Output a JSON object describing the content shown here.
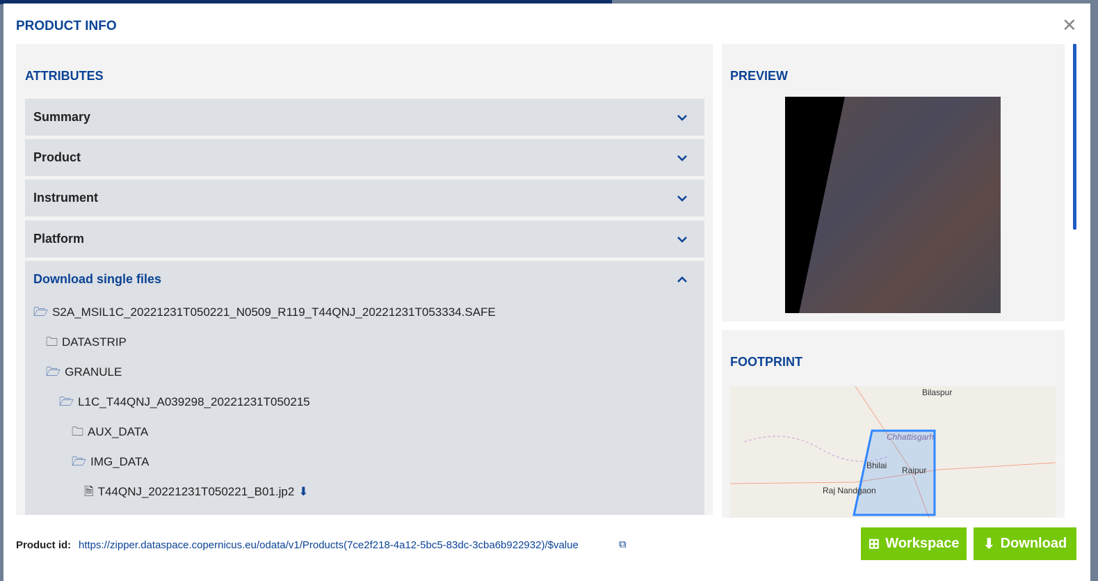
{
  "modal": {
    "title": "PRODUCT INFO",
    "close_icon": "close-icon"
  },
  "attributes": {
    "heading": "ATTRIBUTES",
    "sections": [
      {
        "label": "Summary",
        "expanded": false
      },
      {
        "label": "Product",
        "expanded": false
      },
      {
        "label": "Instrument",
        "expanded": false
      },
      {
        "label": "Platform",
        "expanded": false
      },
      {
        "label": "Download single files",
        "expanded": true
      }
    ]
  },
  "files": [
    {
      "name": "S2A_MSIL1C_20221231T050221_N0509_R119_T44QNJ_20221231T053334.SAFE",
      "type": "folder-open"
    },
    {
      "name": "DATASTRIP",
      "type": "folder"
    },
    {
      "name": "GRANULE",
      "type": "folder-open"
    },
    {
      "name": "L1C_T44QNJ_A039298_20221231T050215",
      "type": "folder-open"
    },
    {
      "name": "AUX_DATA",
      "type": "folder"
    },
    {
      "name": "IMG_DATA",
      "type": "folder-open"
    },
    {
      "name": "T44QNJ_20221231T050221_B01.jp2",
      "type": "file"
    }
  ],
  "preview": {
    "heading": "PREVIEW"
  },
  "footprint": {
    "heading": "FOOTPRINT",
    "labels": {
      "bilaspur": "Bilaspur",
      "chhattisgarh": "Chhattisgarh",
      "bhilai": "Bhilai",
      "raipur": "Raipur",
      "rajnandgaon": "Raj Nandgaon"
    },
    "polygon_color": "#2f86ff"
  },
  "footer": {
    "product_id_label": "Product id:",
    "product_id": "https://zipper.dataspace.copernicus.eu/odata/v1/Products(7ce2f218-4a12-5bc5-83dc-3cba6b922932)/$value",
    "workspace_label": "Workspace",
    "download_label": "Download",
    "button_color": "#76c80a"
  }
}
